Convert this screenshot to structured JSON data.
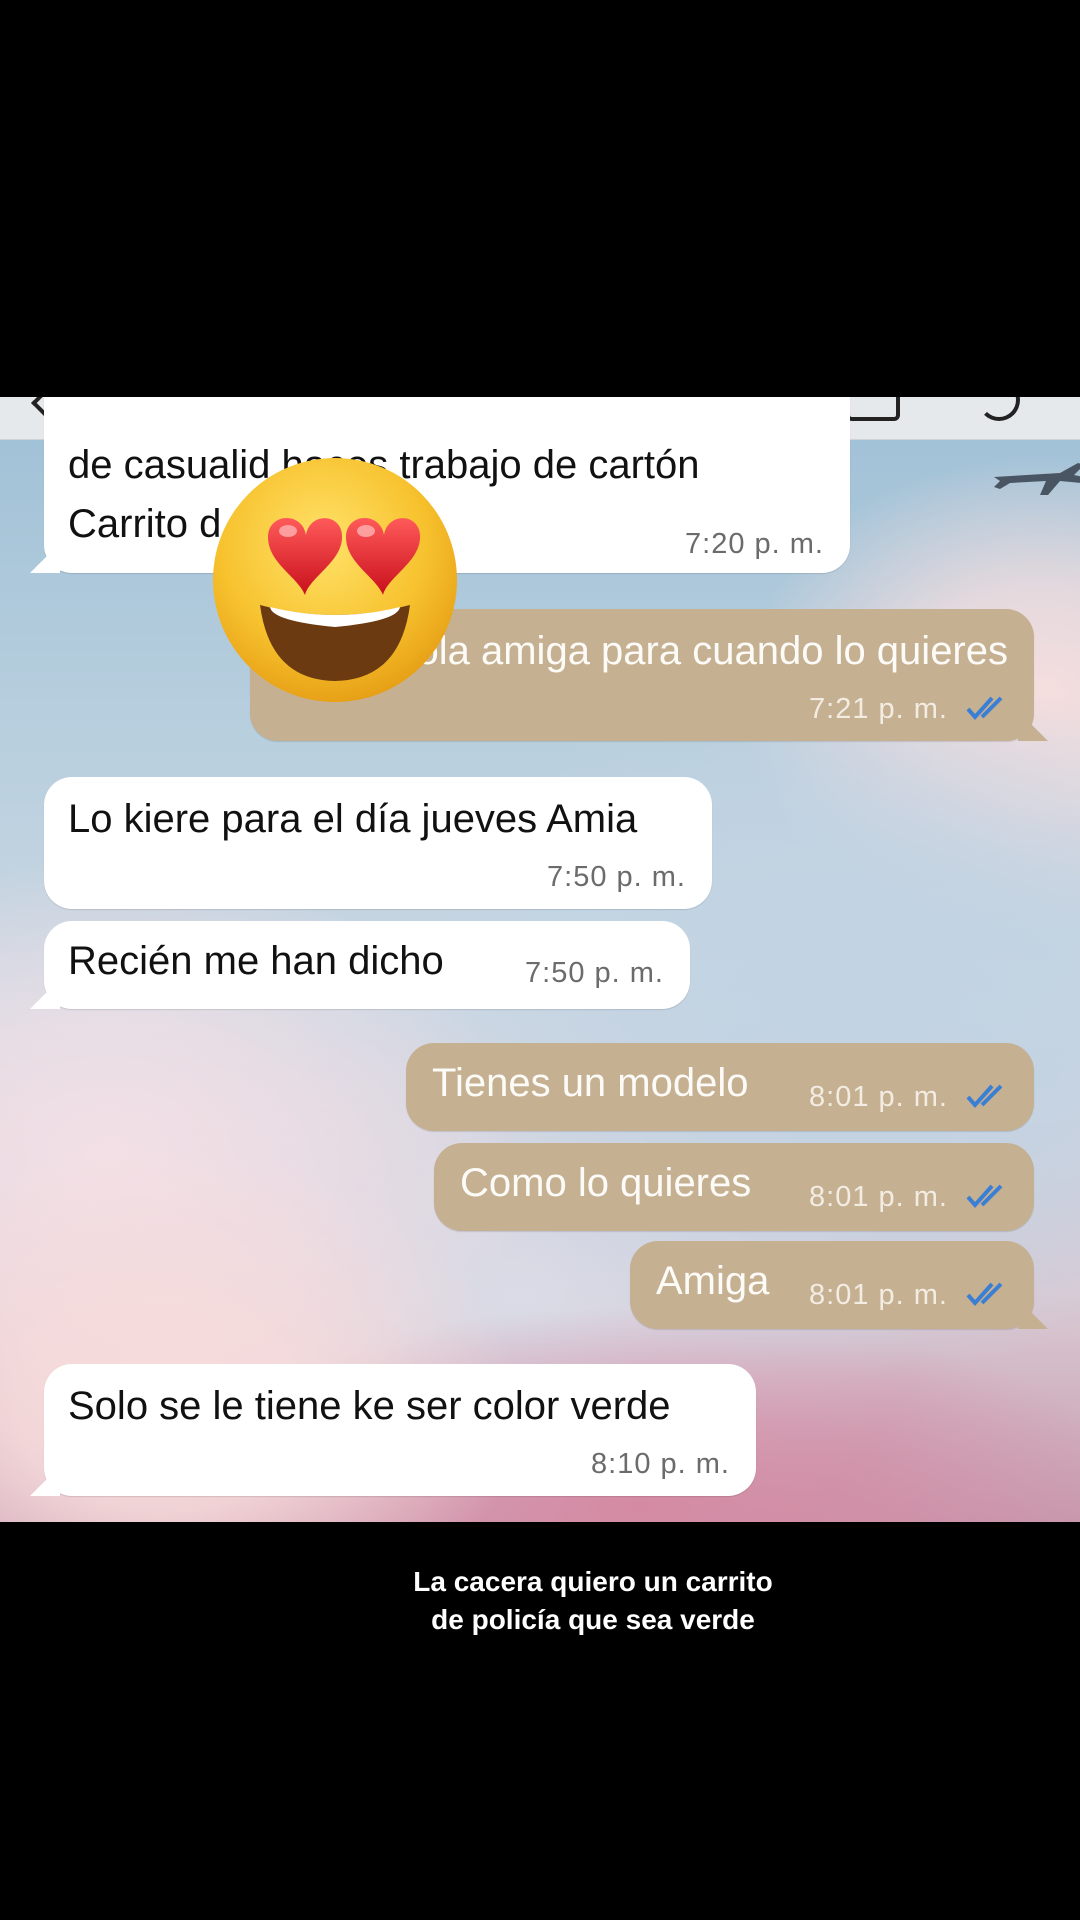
{
  "chat": {
    "messages": [
      {
        "dir": "in",
        "text_line1": "de casualid   haces trabajo de cartón",
        "text_line2": "Carrito d",
        "time": "7:20 p. m."
      },
      {
        "dir": "out",
        "text": "Hola amiga para cuando lo quieres",
        "time": "7:21 p. m.",
        "status": "read"
      },
      {
        "dir": "in",
        "text": "Lo kiere para el día jueves Amia",
        "time": "7:50 p. m."
      },
      {
        "dir": "in",
        "text": "Recién me han dicho",
        "time": "7:50 p. m."
      },
      {
        "dir": "out",
        "text": "Tienes un modelo",
        "time": "8:01 p. m.",
        "status": "read"
      },
      {
        "dir": "out",
        "text": "Como lo quieres",
        "time": "8:01 p. m.",
        "status": "read"
      },
      {
        "dir": "out",
        "text": "Amiga",
        "time": "8:01 p. m.",
        "status": "read"
      },
      {
        "dir": "in",
        "text": "Solo se le tiene ke ser color verde",
        "time": "8:10 p. m."
      }
    ]
  },
  "overlay": {
    "emoji_icon": "heart-eyes-emoji",
    "caption_line1": "La cacera quiero un carrito",
    "caption_line2": "de policía que sea verde"
  },
  "colors": {
    "incoming_bubble": "#ffffff",
    "outgoing_bubble": "#c5b092",
    "read_ticks": "#3b7fd4"
  }
}
